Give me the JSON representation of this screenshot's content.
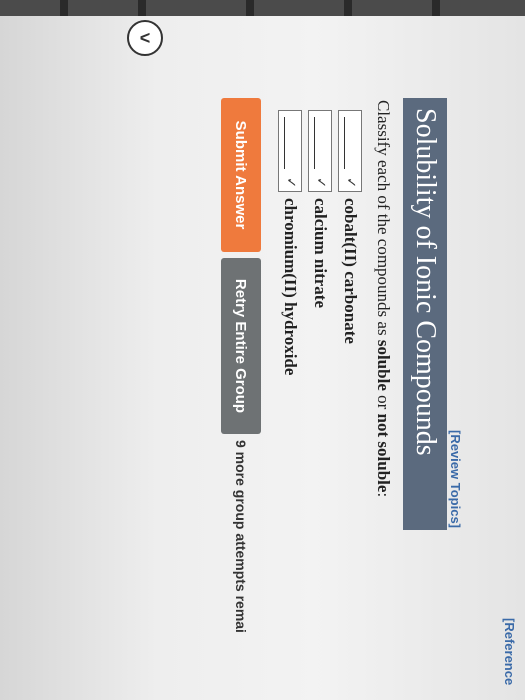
{
  "links": {
    "review_topics": "[Review Topics]",
    "references": "[Reference"
  },
  "title": "Solubility of Ionic Compounds",
  "instructions": {
    "before": "Classify each of the compounds as ",
    "soluble": "soluble",
    "middle": " or ",
    "not_soluble": "not soluble",
    "after": ":"
  },
  "compounds": [
    {
      "name": "cobalt(II) carbonate",
      "selected": ""
    },
    {
      "name": "calcium nitrate",
      "selected": ""
    },
    {
      "name": "chromium(II) hydroxide",
      "selected": ""
    }
  ],
  "buttons": {
    "submit": "Submit Answer",
    "retry": "Retry Entire Group"
  },
  "attempts_text": "9 more group attempts remai",
  "colors": {
    "title_bar": "#5b6a7e",
    "submit": "#ef7a3d",
    "retry": "#6e7274",
    "link": "#3a6aa8"
  }
}
